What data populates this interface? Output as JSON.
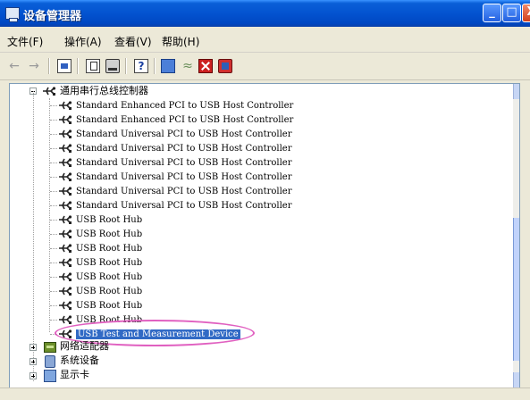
{
  "window": {
    "title": "设备管理器",
    "buttons": {
      "minimize": "",
      "maximize": "",
      "close": "X"
    }
  },
  "menu": [
    {
      "label": "文件(F)"
    },
    {
      "label": "操作(A)"
    },
    {
      "label": "查看(V)"
    },
    {
      "label": "帮助(H)"
    }
  ],
  "toolbar": {
    "icons": [
      "back-arrow-icon",
      "forward-arrow-icon",
      "properties-icon",
      "scan-icon",
      "print-icon",
      "help-icon",
      "monitor-icon",
      "update-driver-icon",
      "disable-icon",
      "uninstall-icon"
    ]
  },
  "tree": {
    "usb_controller_group": "通用串行总线控制器",
    "usb_children": [
      "Standard Enhanced PCI to USB Host Controller",
      "Standard Enhanced PCI to USB Host Controller",
      "Standard Universal PCI to USB Host Controller",
      "Standard Universal PCI to USB Host Controller",
      "Standard Universal PCI to USB Host Controller",
      "Standard Universal PCI to USB Host Controller",
      "Standard Universal PCI to USB Host Controller",
      "Standard Universal PCI to USB Host Controller",
      "USB Root Hub",
      "USB Root Hub",
      "USB Root Hub",
      "USB Root Hub",
      "USB Root Hub",
      "USB Root Hub",
      "USB Root Hub",
      "USB Root Hub",
      "USB Test and Measurement Device"
    ],
    "selected_index": 16,
    "other_groups": [
      "网络适配器",
      "系统设备",
      "显示卡"
    ]
  },
  "colors": {
    "titlebar": "#0353d0",
    "selection": "#316ac5",
    "highlight_circle": "#e060c0"
  }
}
